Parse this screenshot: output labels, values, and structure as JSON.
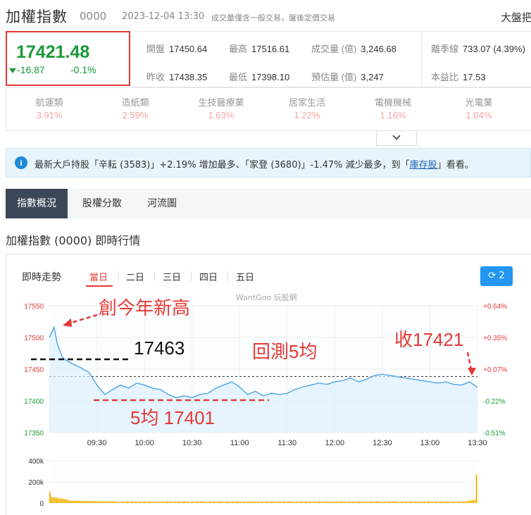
{
  "header": {
    "title": "加權指數",
    "code": "0000",
    "datetime": "2023-12-04 13:30",
    "note": "成交量僅含一般交易，盤後定價交易",
    "right_label": "大盤把"
  },
  "price": {
    "value": "17421.48",
    "change": "-16.87",
    "percent": "-0.1%",
    "color": "#1a9a38"
  },
  "stats": {
    "open_label": "開盤",
    "open": "17450.64",
    "high_label": "最高",
    "high": "17516.61",
    "volume_label": "成交量 (億)",
    "volume": "3,246.68",
    "season_label": "離季線",
    "season": "733.07 (4.39%)",
    "prev_label": "昨收",
    "prev": "17438.35",
    "low_label": "最低",
    "low": "17398.10",
    "est_label": "預估量 (億)",
    "est": "3,247",
    "pe_label": "本益比",
    "pe": "17.53"
  },
  "sectors": [
    {
      "name": "航運類",
      "pct": "3.91%"
    },
    {
      "name": "造紙類",
      "pct": "2.59%"
    },
    {
      "name": "生技醫療業",
      "pct": "1.63%"
    },
    {
      "name": "居家生活",
      "pct": "1.22%"
    },
    {
      "name": "電機機械",
      "pct": "1.16%"
    },
    {
      "name": "光電業",
      "pct": "1.04%"
    }
  ],
  "info": {
    "text_before": "最新大戶持股「辛耘 (3583)」+2.19% 增加最多、「家登 (3680)」-1.47% 減少最多，到「",
    "link": "庫存股",
    "text_after": "」看看。"
  },
  "tabs": [
    "指數概況",
    "股權分散",
    "河流圖"
  ],
  "section_title": "加權指數 (0000) 即時行情",
  "realtime": {
    "label": "即時走勢",
    "ranges": [
      "當日",
      "二日",
      "三日",
      "四日",
      "五日"
    ],
    "active_range": "當日",
    "refresh_count": "2",
    "brand": "WantGoo 玩股網"
  },
  "chart_data": {
    "type": "line",
    "title": "",
    "y_ticks_left": [
      "17550",
      "17500",
      "17450",
      "17400",
      "17350"
    ],
    "y_ticks_right": [
      "+0.64%",
      "+0.35%",
      "+0.07%",
      "-0.22%",
      "-0.51%"
    ],
    "x_ticks": [
      "09:30",
      "10:00",
      "10:30",
      "11:00",
      "11:30",
      "12:00",
      "12:30",
      "13:00",
      "13:30"
    ],
    "ylim": [
      17350,
      17550
    ],
    "reference_close": 17438.35,
    "series": [
      {
        "x": [
          "09:00",
          "09:03",
          "09:05",
          "09:08",
          "09:10",
          "09:15",
          "09:20",
          "09:25",
          "09:30",
          "09:35",
          "09:40",
          "09:45",
          "09:50",
          "09:55",
          "10:00",
          "10:05",
          "10:10",
          "10:15",
          "10:20",
          "10:25",
          "10:30",
          "10:35",
          "10:40",
          "10:45",
          "10:50",
          "10:55",
          "11:00",
          "11:05",
          "11:10",
          "11:15",
          "11:20",
          "11:25",
          "11:30",
          "11:35",
          "11:40",
          "11:45",
          "11:50",
          "11:55",
          "12:00",
          "12:05",
          "12:10",
          "12:15",
          "12:20",
          "12:25",
          "12:30",
          "12:35",
          "12:40",
          "12:45",
          "12:50",
          "12:55",
          "13:00",
          "13:05",
          "13:10",
          "13:15",
          "13:20",
          "13:25",
          "13:30"
        ],
        "values": [
          17500,
          17516,
          17490,
          17470,
          17465,
          17458,
          17452,
          17445,
          17425,
          17410,
          17418,
          17425,
          17420,
          17428,
          17425,
          17420,
          17418,
          17410,
          17405,
          17408,
          17405,
          17410,
          17412,
          17420,
          17425,
          17430,
          17422,
          17410,
          17415,
          17408,
          17412,
          17410,
          17412,
          17418,
          17422,
          17425,
          17428,
          17426,
          17430,
          17432,
          17436,
          17430,
          17434,
          17440,
          17442,
          17440,
          17438,
          17436,
          17434,
          17432,
          17430,
          17428,
          17430,
          17426,
          17425,
          17430,
          17421.48
        ]
      }
    ],
    "volume": {
      "y_ticks": [
        "400k",
        "200k",
        "0"
      ],
      "ylim": [
        0,
        400000
      ]
    },
    "annotations": [
      {
        "text": "創今年新高",
        "color": "#e53935"
      },
      {
        "text": "17463",
        "color": "#111111"
      },
      {
        "text": "回測5均",
        "color": "#e53935"
      },
      {
        "text": "收17421",
        "color": "#e53935"
      },
      {
        "text": "5均 17401",
        "color": "#e53935"
      }
    ]
  }
}
